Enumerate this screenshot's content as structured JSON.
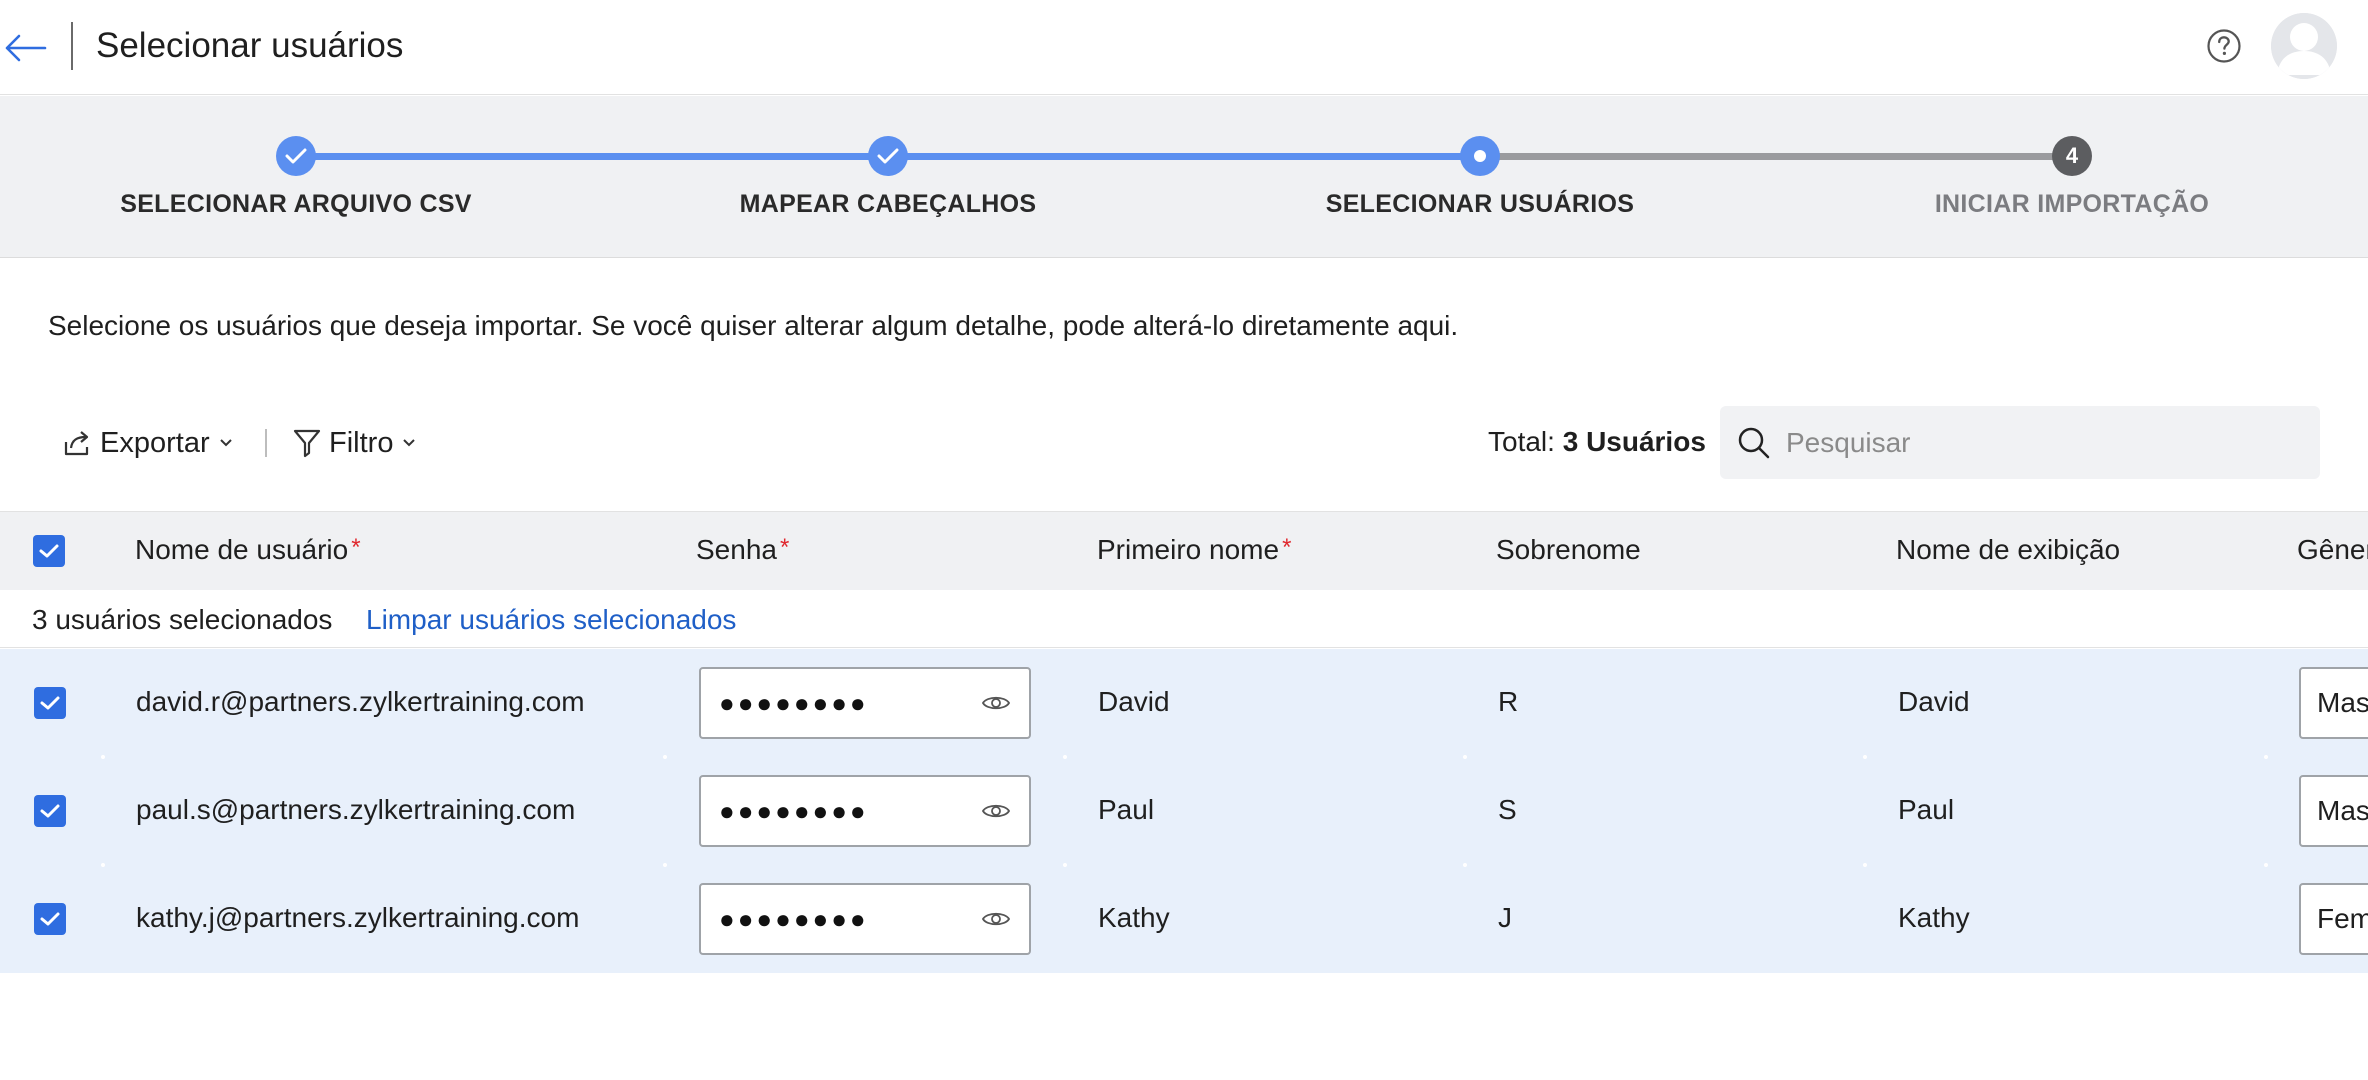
{
  "header": {
    "title": "Selecionar usuários",
    "back_icon": "arrow-left-icon",
    "help_icon": "question-circle-icon",
    "avatar_icon": "user-avatar-icon"
  },
  "stepper": {
    "steps": [
      {
        "label": "SELECIONAR ARQUIVO CSV",
        "state": "done"
      },
      {
        "label": "MAPEAR CABEÇALHOS",
        "state": "done"
      },
      {
        "label": "SELECIONAR USUÁRIOS",
        "state": "current"
      },
      {
        "label": "INICIAR IMPORTAÇÃO",
        "state": "todo",
        "number": "4"
      }
    ],
    "colors": {
      "active": "#5b8ff0",
      "inactive": "#9a9b9e"
    }
  },
  "description": "Selecione os usuários que deseja importar. Se você quiser alterar algum detalhe, pode alterá-lo diretamente aqui.",
  "toolbar": {
    "export_label": "Exportar",
    "filter_label": "Filtro",
    "total_prefix": "Total:",
    "total_value": "3 Usuários",
    "search_placeholder": "Pesquisar"
  },
  "table": {
    "columns": [
      {
        "label": "Nome de usuário",
        "required": "*"
      },
      {
        "label": "Senha",
        "required": "*"
      },
      {
        "label": "Primeiro nome",
        "required": "*"
      },
      {
        "label": "Sobrenome"
      },
      {
        "label": "Nome de exibição"
      },
      {
        "label": "Gêner"
      }
    ],
    "selection": {
      "count_text": "3 usuários selecionados",
      "clear_text": "Limpar usuários selecionados"
    },
    "rows": [
      {
        "email": "david.r@partners.zylkertraining.com",
        "password": "●●●●●●●●",
        "first": "David",
        "last": "R",
        "display": "David",
        "gender": "Mas"
      },
      {
        "email": "paul.s@partners.zylkertraining.com",
        "password": "●●●●●●●●",
        "first": "Paul",
        "last": "S",
        "display": "Paul",
        "gender": "Mas"
      },
      {
        "email": "kathy.j@partners.zylkertraining.com",
        "password": "●●●●●●●●",
        "first": "Kathy",
        "last": "J",
        "display": "Kathy",
        "gender": "Fem"
      }
    ],
    "colors": {
      "checkbox": "#2f6de0",
      "row_bg": "#e8f0fb",
      "link": "#1f5fc7",
      "required": "#e0282e"
    }
  }
}
